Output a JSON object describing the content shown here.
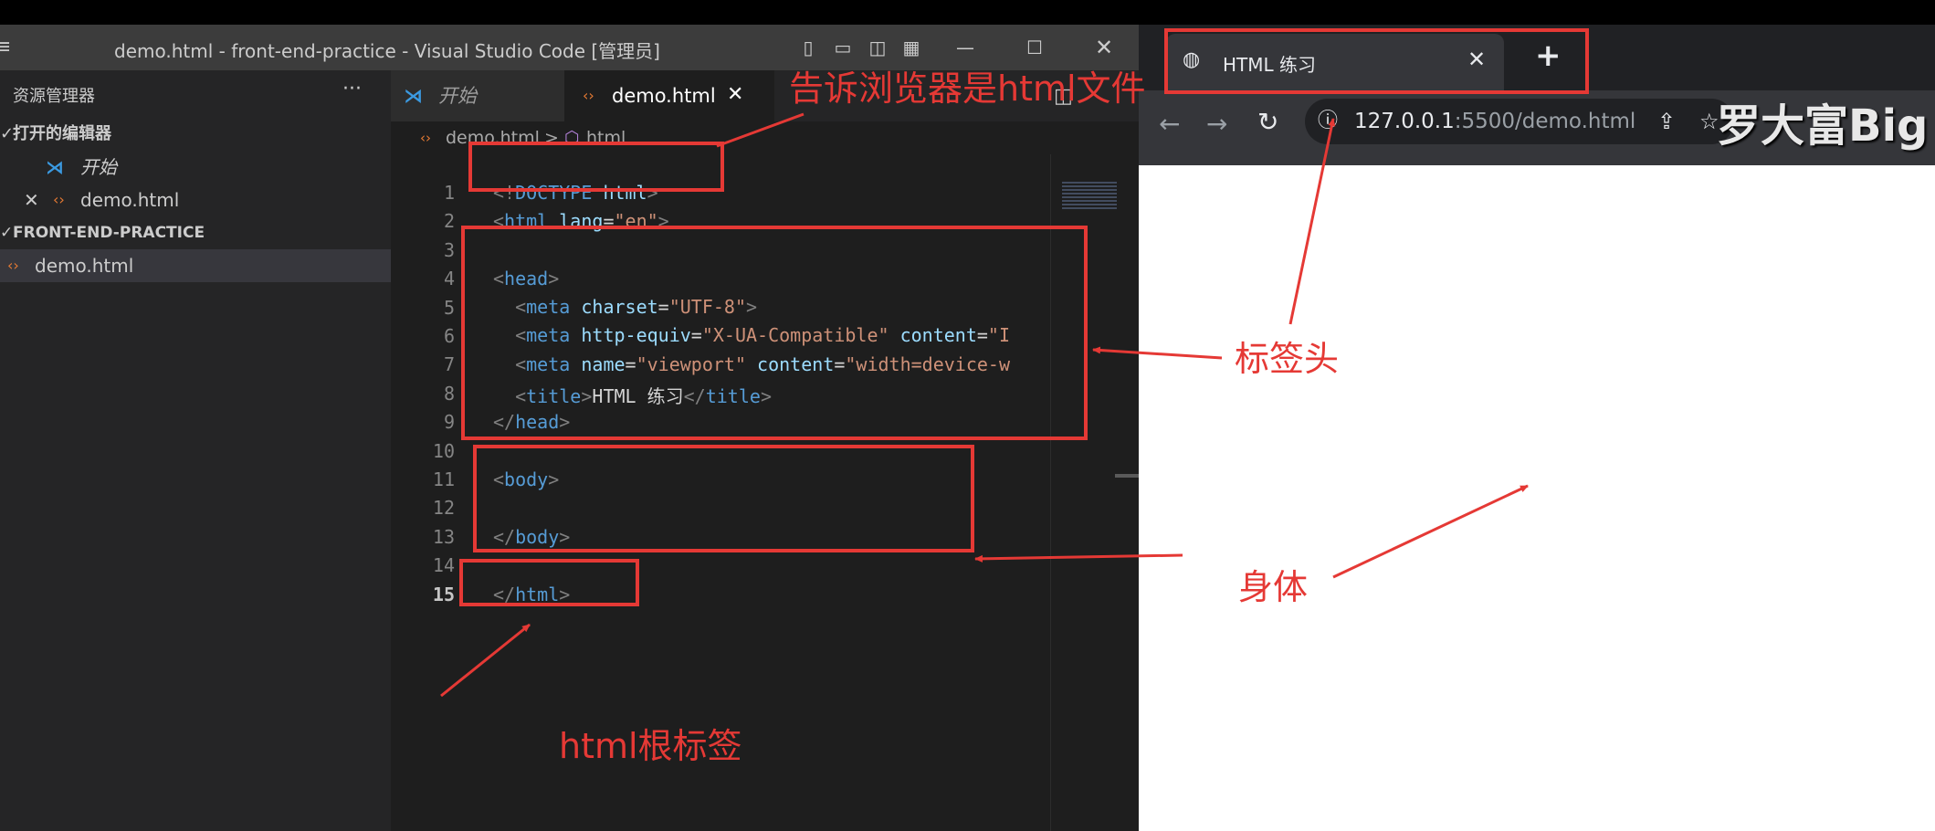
{
  "vscode": {
    "window_title": "demo.html - front-end-practice - Visual Studio Code [管理员]",
    "explorer_title": "资源管理器",
    "explorer_more": "···",
    "open_editors_label": "打开的编辑器",
    "open_editors": [
      {
        "label": "开始"
      },
      {
        "label": "demo.html"
      }
    ],
    "workspace_label": "FRONT-END-PRACTICE",
    "workspace_files": [
      {
        "label": "demo.html"
      }
    ],
    "tabs": [
      {
        "label": "开始"
      },
      {
        "label": "demo.html"
      }
    ],
    "breadcrumb": {
      "file": "demo.html",
      "separator": ">",
      "node": "html"
    },
    "line_numbers": [
      "1",
      "2",
      "3",
      "4",
      "5",
      "6",
      "7",
      "8",
      "9",
      "10",
      "11",
      "12",
      "13",
      "14",
      "15"
    ],
    "code": {
      "doctype_open": "<!",
      "doctype_kw": "DOCTYPE",
      "doctype_name": "html",
      "doctype_close": ">",
      "html_tag": "html",
      "lang_attr": "lang",
      "lang_val": "\"en\"",
      "head_tag": "head",
      "meta_tag": "meta",
      "charset_attr": "charset",
      "charset_val": "\"UTF-8\"",
      "httpequiv_attr": "http-equiv",
      "httpequiv_val": "\"X-UA-Compatible\"",
      "content_attr": "content",
      "content_val_trunc": "\"I",
      "name_attr": "name",
      "name_val": "\"viewport\"",
      "viewport_content_trunc": "\"width=device-w",
      "title_tag": "title",
      "title_text": "HTML 练习",
      "body_tag": "body"
    }
  },
  "browser": {
    "tab_title": "HTML 练习",
    "url_host": "127.0.0.1",
    "url_rest": ":5500/demo.html"
  },
  "annotations": {
    "doctype_note": "告诉浏览器是html文件",
    "head_note": "标签头",
    "body_note": "身体",
    "root_note": "html根标签"
  },
  "watermark": "罗大富Big",
  "colors": {
    "annotation_red": "#e53935",
    "vscode_bg": "#1e1e1e",
    "tag_blue": "#569cd6",
    "string_orange": "#ce9178",
    "attr_lightblue": "#9cdcfe"
  }
}
